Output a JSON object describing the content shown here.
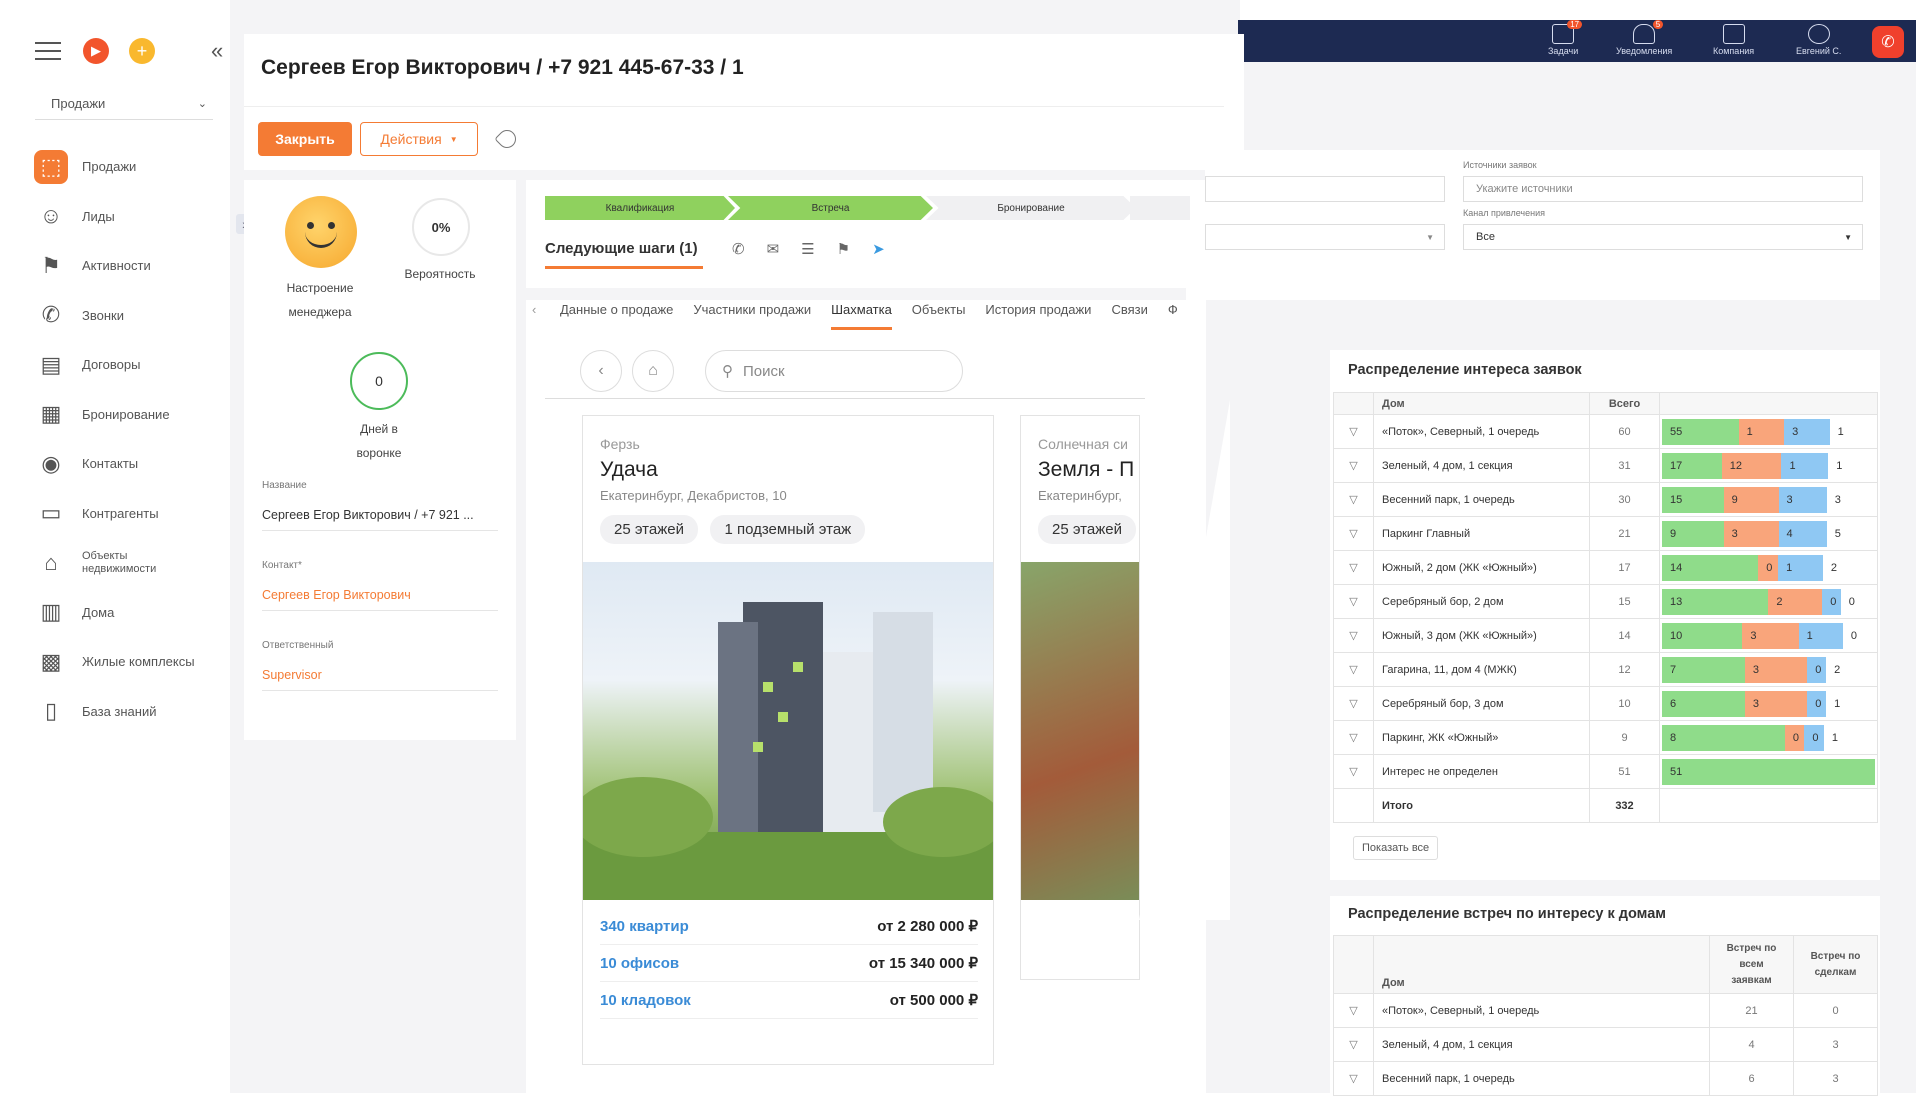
{
  "sidebar": {
    "dropdown": "Продажи",
    "items": [
      {
        "label": "Продажи",
        "icon": "sales-icon",
        "active": true
      },
      {
        "label": "Лиды",
        "icon": "leads-icon"
      },
      {
        "label": "Активности",
        "icon": "flag-icon"
      },
      {
        "label": "Звонки",
        "icon": "phone-icon"
      },
      {
        "label": "Договоры",
        "icon": "contract-icon"
      },
      {
        "label": "Бронирование",
        "icon": "calendar-icon"
      },
      {
        "label": "Контакты",
        "icon": "contact-icon"
      },
      {
        "label": "Контрагенты",
        "icon": "document-icon"
      },
      {
        "label": "Объекты недвижимости",
        "icon": "home-icon"
      },
      {
        "label": "Дома",
        "icon": "building-icon"
      },
      {
        "label": "Жилые комплексы",
        "icon": "complex-icon"
      },
      {
        "label": "База знаний",
        "icon": "book-icon"
      }
    ]
  },
  "header": {
    "title": "Сергеев Егор Викторович / +7 921 445-67-33 / 1",
    "close_btn": "Закрыть",
    "actions_btn": "Действия"
  },
  "topbar": {
    "items": [
      {
        "label": "Задачи",
        "badge": "17"
      },
      {
        "label": "Уведомления",
        "badge": "5"
      },
      {
        "label": "Компания",
        "badge": ""
      },
      {
        "label": "Евгений С.",
        "badge": ""
      }
    ]
  },
  "info": {
    "mood_label": "Настроение менеджера",
    "probability_value": "0%",
    "probability_label": "Вероятность",
    "days_value": "0",
    "days_label": "Дней в воронке",
    "name_label": "Название",
    "name_value": "Сергеев Егор Викторович / +7 921 ...",
    "contact_label": "Контакт*",
    "contact_value": "Сергеев Егор Викторович",
    "resp_label": "Ответственный",
    "resp_value": "Supervisor"
  },
  "stages": [
    "Квалификация",
    "Встреча",
    "Бронирование"
  ],
  "next_steps": "Следующие шаги (1)",
  "tabs": [
    "Данные о продаже",
    "Участники продажи",
    "Шахматка",
    "Объекты",
    "История продажи",
    "Связи",
    "Ф"
  ],
  "active_tab": "Шахматка",
  "search_placeholder": "Поиск",
  "building1": {
    "sub": "Ферзь",
    "name": "Удача",
    "address": "Екатеринбург, Декабристов, 10",
    "floors": "25 этажей",
    "underground": "1 подземный этаж",
    "rows": [
      {
        "link": "340 квартир",
        "price": "от 2 280 000 ₽"
      },
      {
        "link": "10 офисов",
        "price": "от 15 340 000 ₽"
      },
      {
        "link": "10 кладовок",
        "price": "от 500 000 ₽"
      }
    ]
  },
  "building2": {
    "sub": "Солнечная си",
    "name": "Земля - П",
    "address": "Екатеринбург,",
    "floors": "25 этажей"
  },
  "filters": {
    "sources_label": "Источники заявок",
    "sources_placeholder": "Укажите источники",
    "channel_label": "Канал привлечения",
    "channel_value": "Все"
  },
  "table1": {
    "title": "Распределение интереса заявок",
    "col_house": "Дом",
    "col_total": "Всего",
    "rows": [
      {
        "house": "«Поток», Северный, 1 очередь",
        "total": "60",
        "seg": [
          "55",
          "1",
          "3",
          "1"
        ],
        "w": [
          55,
          30,
          30,
          30
        ]
      },
      {
        "house": "Зеленый, 4 дом, 1 секция",
        "total": "31",
        "seg": [
          "17",
          "12",
          "1",
          "1"
        ],
        "w": [
          40,
          40,
          30,
          30
        ]
      },
      {
        "house": "Весенний парк, 1 очередь",
        "total": "30",
        "seg": [
          "15",
          "9",
          "3",
          "3"
        ],
        "w": [
          40,
          35,
          30,
          30
        ]
      },
      {
        "house": "Паркинг Главный",
        "total": "21",
        "seg": [
          "9",
          "3",
          "4",
          "5"
        ],
        "w": [
          40,
          35,
          30,
          30
        ]
      },
      {
        "house": "Южный, 2 дом (ЖК «Южный»)",
        "total": "17",
        "seg": [
          "14",
          "0",
          "1",
          "2"
        ],
        "w": [
          60,
          8,
          25,
          30
        ]
      },
      {
        "house": "Серебряный бор, 2 дом",
        "total": "15",
        "seg": [
          "13",
          "2",
          "0",
          "0"
        ],
        "w": [
          75,
          35,
          8,
          20
        ]
      },
      {
        "house": "Южный, 3 дом (ЖК «Южный»)",
        "total": "14",
        "seg": [
          "10",
          "3",
          "1",
          "0"
        ],
        "w": [
          60,
          40,
          30,
          20
        ]
      },
      {
        "house": "Гагарина, 11, дом 4 (МЖК)",
        "total": "12",
        "seg": [
          "7",
          "3",
          "0",
          "2"
        ],
        "w": [
          55,
          40,
          8,
          30
        ]
      },
      {
        "house": "Серебряный бор, 3 дом",
        "total": "10",
        "seg": [
          "6",
          "3",
          "0",
          "1"
        ],
        "w": [
          55,
          40,
          8,
          30
        ]
      },
      {
        "house": "Паркинг, ЖК «Южный»",
        "total": "9",
        "seg": [
          "8",
          "0",
          "0",
          "1"
        ],
        "w": [
          80,
          8,
          8,
          30
        ]
      },
      {
        "house": "Интерес не определен",
        "total": "51",
        "seg": [
          "51",
          "",
          "",
          ""
        ],
        "w": [
          100,
          0,
          0,
          0
        ]
      }
    ],
    "total_label": "Итого",
    "total_value": "332",
    "show_all": "Показать все"
  },
  "table2": {
    "title": "Распределение встреч по интересу к домам",
    "col_house": "Дом",
    "col_all": "Встреч по всем заявкам",
    "col_deals": "Встреч по сделкам",
    "rows": [
      {
        "house": "«Поток», Северный, 1 очередь",
        "all": "21",
        "deals": "0"
      },
      {
        "house": "Зеленый, 4 дом, 1 секция",
        "all": "4",
        "deals": "3"
      },
      {
        "house": "Весенний парк, 1 очередь",
        "all": "6",
        "deals": "3"
      }
    ]
  },
  "colors": {
    "accent": "#f47b34",
    "green": "#8fdc8a",
    "orange": "#f9a57b",
    "blue": "#8fc8f3",
    "header": "#1d2a52"
  }
}
